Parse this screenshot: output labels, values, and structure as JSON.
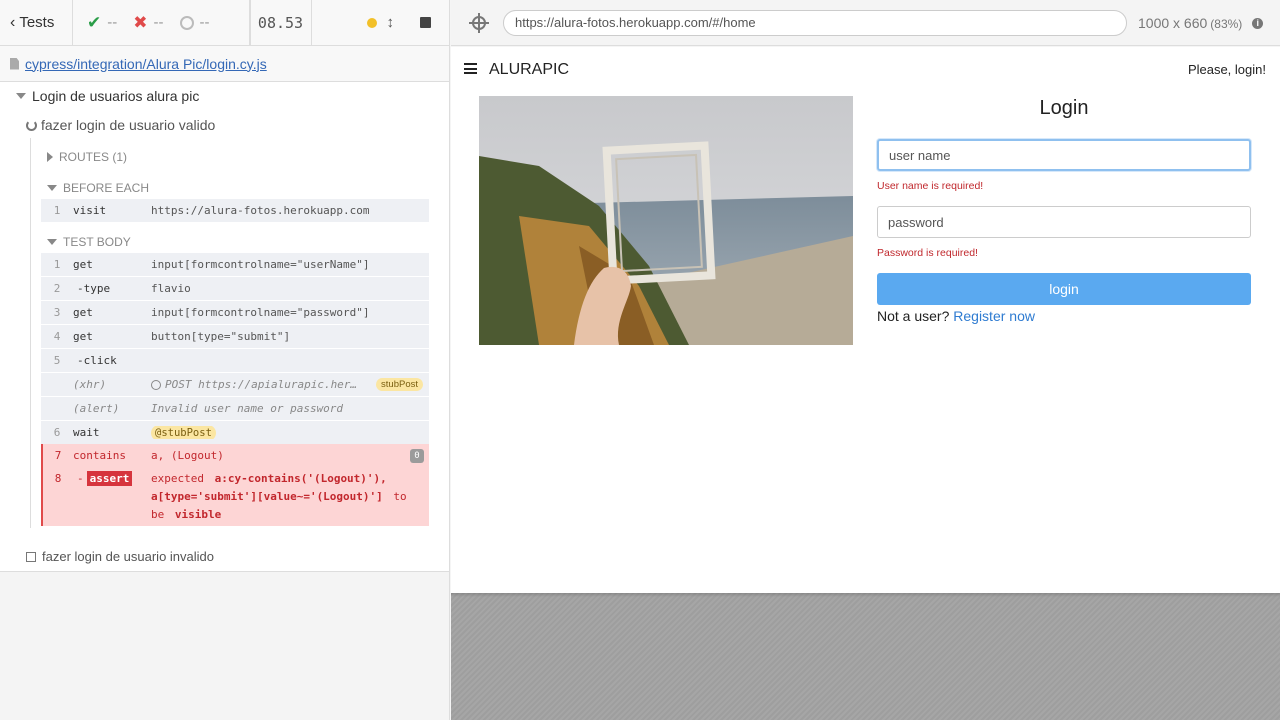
{
  "stats": {
    "tests_label": "Tests",
    "passed": "--",
    "failed": "--",
    "pending": "--",
    "duration": "08.53"
  },
  "spec": {
    "path": "cypress/integration/Alura Pic/login.cy.js"
  },
  "suite": {
    "title": "Login de usuarios alura pic",
    "test_active": "fazer login de usuario valido",
    "routes_label": "ROUTES (1)",
    "before_each_label": "BEFORE EACH",
    "test_body_label": "TEST BODY",
    "test_inactive": "fazer login de usuario invalido"
  },
  "before_each": [
    {
      "n": "1",
      "name": "visit",
      "msg": "https://alura-fotos.herokuapp.com"
    }
  ],
  "commands": [
    {
      "n": "1",
      "name": "get",
      "msg": "input[formcontrolname=\"userName\"]"
    },
    {
      "n": "2",
      "name": "-type",
      "msg": "flavio"
    },
    {
      "n": "3",
      "name": "get",
      "msg": "input[formcontrolname=\"password\"]"
    },
    {
      "n": "4",
      "name": "get",
      "msg": "button[type=\"submit\"]"
    },
    {
      "n": "5",
      "name": "-click",
      "msg": ""
    },
    {
      "n": "",
      "name": "(xhr)",
      "msg": "POST https://apialurapic.her…",
      "badge": "stubPost"
    },
    {
      "n": "",
      "name": "(alert)",
      "msg": "Invalid user name or password"
    },
    {
      "n": "6",
      "name": "wait",
      "alias": "@stubPost"
    }
  ],
  "failure": {
    "cmd7_n": "7",
    "cmd7_name": "contains",
    "cmd7_msg": "a, (Logout)",
    "cmd7_badge": "0",
    "cmd8_n": "8",
    "cmd8_prefix": "-",
    "cmd8_name": "assert",
    "msg_expected": "expected",
    "msg_selector": "a:cy-contains('(Logout)'), a[type='submit'][value~='(Logout)']",
    "msg_to": "to",
    "msg_be": "be",
    "msg_visible": "visible"
  },
  "aut": {
    "url": "https://alura-fotos.herokuapp.com/#/home",
    "viewport": "1000 x 660",
    "scale": "(83%)"
  },
  "app": {
    "brand": "ALURAPIC",
    "please_login": "Please, login!",
    "login_title": "Login",
    "username_placeholder": "user name",
    "username_error": "User name is required!",
    "password_placeholder": "password",
    "password_error": "Password is required!",
    "login_button": "login",
    "not_user": "Not a user?",
    "register_link": "Register now"
  }
}
